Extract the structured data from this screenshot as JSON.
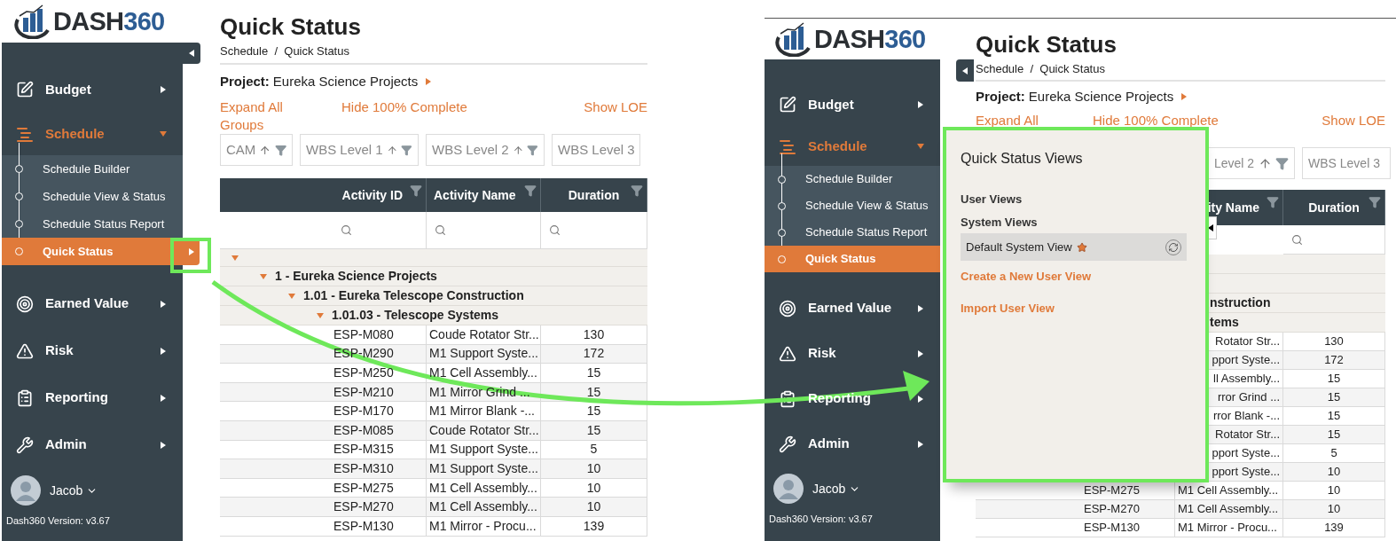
{
  "screens": [
    {
      "logo": {
        "text": "DASH",
        "accent": "360"
      },
      "sidebar": {
        "items": [
          {
            "label": "Budget",
            "expanded": false
          },
          {
            "label": "Schedule",
            "expanded": true,
            "children": [
              {
                "label": "Schedule Builder",
                "selected": false
              },
              {
                "label": "Schedule View & Status",
                "selected": false
              },
              {
                "label": "Schedule Status Report",
                "selected": false
              },
              {
                "label": "Quick Status",
                "selected": true
              }
            ]
          },
          {
            "label": "Earned Value",
            "expanded": false
          },
          {
            "label": "Risk",
            "expanded": false
          },
          {
            "label": "Reporting",
            "expanded": false
          },
          {
            "label": "Admin",
            "expanded": false
          }
        ]
      },
      "flyout_button": true,
      "user": {
        "name": "Jacob",
        "version": "Dash360 Version: v3.67"
      },
      "page": {
        "title": "Quick Status",
        "breadcrumb": "Schedule  /  Quick Status",
        "project": {
          "label": "Project:",
          "name": "Eureka Science Projects"
        },
        "actions": [
          "Expand All Groups",
          "Hide 100% Complete",
          "Show LOE"
        ],
        "filters": [
          {
            "label": "CAM",
            "controls": true
          },
          {
            "label": "WBS Level 1",
            "controls": true
          },
          {
            "label": "WBS Level 2",
            "controls": true
          },
          {
            "label": "WBS Level 3"
          }
        ],
        "table": {
          "columns": [
            "Activity ID",
            "Activity Name",
            "Duration"
          ],
          "rows": [
            {
              "kind": "group",
              "expanded": true,
              "children": [
                {
                  "kind": "group",
                  "label": "1 - Eureka Science Projects",
                  "expanded": true,
                  "children": [
                    {
                      "kind": "group",
                      "label": "1.01 - Eureka Telescope Construction",
                      "expanded": true,
                      "children": [
                        {
                          "kind": "group",
                          "label": "1.01.03 - Telescope Systems",
                          "expanded": true,
                          "children": [
                            {
                              "kind": "activity",
                              "id": "ESP-M080",
                              "name": "Coude Rotator Str...",
                              "duration": "130"
                            },
                            {
                              "kind": "activity",
                              "id": "ESP-M290",
                              "name": "M1 Support Syste...",
                              "duration": "172"
                            },
                            {
                              "kind": "activity",
                              "id": "ESP-M250",
                              "name": "M1 Cell Assembly...",
                              "duration": "15"
                            },
                            {
                              "kind": "activity",
                              "id": "ESP-M210",
                              "name": "M1 Mirror Grind ...",
                              "duration": "15"
                            },
                            {
                              "kind": "activity",
                              "id": "ESP-M170",
                              "name": "M1 Mirror Blank -...",
                              "duration": "15"
                            },
                            {
                              "kind": "activity",
                              "id": "ESP-M085",
                              "name": "Coude Rotator Str...",
                              "duration": "15"
                            },
                            {
                              "kind": "activity",
                              "id": "ESP-M315",
                              "name": "M1 Support Syste...",
                              "duration": "5"
                            },
                            {
                              "kind": "activity",
                              "id": "ESP-M310",
                              "name": "M1 Support Syste...",
                              "duration": "10"
                            },
                            {
                              "kind": "activity",
                              "id": "ESP-M275",
                              "name": "M1 Cell Assembly...",
                              "duration": "10"
                            },
                            {
                              "kind": "activity",
                              "id": "ESP-M270",
                              "name": "M1 Cell Assembly...",
                              "duration": "10"
                            },
                            {
                              "kind": "activity",
                              "id": "ESP-M130",
                              "name": "M1 Mirror - Procu...",
                              "duration": "139"
                            }
                          ]
                        }
                      ]
                    }
                  ]
                }
              ]
            }
          ]
        }
      }
    },
    {
      "logo": {
        "text": "DASH",
        "accent": "360"
      },
      "sidebar": {
        "items": [
          {
            "label": "Budget",
            "expanded": false
          },
          {
            "label": "Schedule",
            "expanded": true,
            "children": [
              {
                "label": "Schedule Builder",
                "selected": false
              },
              {
                "label": "Schedule View & Status",
                "selected": false
              },
              {
                "label": "Schedule Status Report",
                "selected": false
              },
              {
                "label": "Quick Status",
                "selected": true
              }
            ]
          },
          {
            "label": "Earned Value",
            "expanded": false
          },
          {
            "label": "Risk",
            "expanded": false
          },
          {
            "label": "Reporting",
            "expanded": false
          },
          {
            "label": "Admin",
            "expanded": false
          }
        ]
      },
      "flyout_button": false,
      "user": {
        "name": "Jacob",
        "version": "Dash360 Version: v3.67"
      },
      "page": {
        "title": "Quick Status",
        "breadcrumb": "Schedule  /  Quick Status",
        "project": {
          "label": "Project:",
          "name": "Eureka Science Projects"
        },
        "actions": [
          "Expand All",
          "Hide 100% Complete",
          "Show LOE"
        ],
        "filters": [
          {
            "label": "Level 2",
            "controls": true
          },
          {
            "label": "WBS Level 3"
          }
        ],
        "table": {
          "columns": [
            "ity Name",
            "Duration"
          ],
          "rows": [
            {
              "kind": "group",
              "children": [
                {
                  "kind": "group",
                  "children": [
                    {
                      "kind": "group",
                      "label": "nstruction",
                      "children": [
                        {
                          "kind": "group",
                          "label": "tems",
                          "children": [
                            {
                              "kind": "activity",
                              "name": "Rotator Str...",
                              "duration": "130"
                            },
                            {
                              "kind": "activity",
                              "name": "pport Syste...",
                              "duration": "172"
                            },
                            {
                              "kind": "activity",
                              "name": "ll Assembly...",
                              "duration": "15"
                            },
                            {
                              "kind": "activity",
                              "name": "rror Grind ...",
                              "duration": "15"
                            },
                            {
                              "kind": "activity",
                              "name": "rror Blank -...",
                              "duration": "15"
                            },
                            {
                              "kind": "activity",
                              "name": "Rotator Str...",
                              "duration": "15"
                            },
                            {
                              "kind": "activity",
                              "name": "pport Syste...",
                              "duration": "5"
                            },
                            {
                              "kind": "activity",
                              "name": "pport Syste...",
                              "duration": "10"
                            },
                            {
                              "kind": "activity",
                              "id": "ESP-M275",
                              "name": "M1 Cell Assembly...",
                              "duration": "10"
                            },
                            {
                              "kind": "activity",
                              "id": "ESP-M270",
                              "name": "M1 Cell Assembly...",
                              "duration": "10"
                            },
                            {
                              "kind": "activity",
                              "id": "ESP-M130",
                              "name": "M1 Mirror - Procu...",
                              "duration": "139"
                            }
                          ]
                        }
                      ]
                    }
                  ]
                }
              ]
            }
          ]
        }
      },
      "popup": {
        "title": "Quick Status Views",
        "sections": [
          {
            "label": "User Views"
          },
          {
            "label": "System Views",
            "items": [
              {
                "label": "Default System View",
                "default": true
              }
            ]
          }
        ],
        "links": [
          "Create a New User View",
          "Import User View"
        ]
      }
    }
  ]
}
